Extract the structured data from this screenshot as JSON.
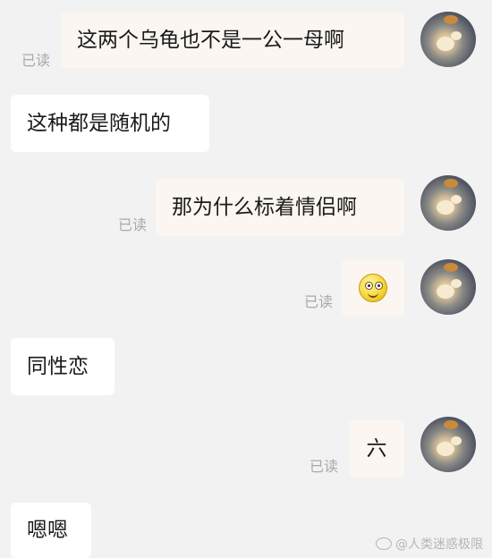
{
  "messages": [
    {
      "side": "out",
      "text": "这两个乌龟也不是一公一母啊",
      "status": "已读"
    },
    {
      "side": "in",
      "text": "这种都是随机的"
    },
    {
      "side": "out",
      "text": "那为什么标着情侣啊",
      "status": "已读"
    },
    {
      "side": "out",
      "emoji": "smiling-face-emoji",
      "status": "已读"
    },
    {
      "side": "in",
      "text": "同性恋"
    },
    {
      "side": "out",
      "text": "六",
      "status": "已读"
    },
    {
      "side": "in",
      "text": "嗯嗯"
    }
  ],
  "watermark": "@人类迷惑极限"
}
